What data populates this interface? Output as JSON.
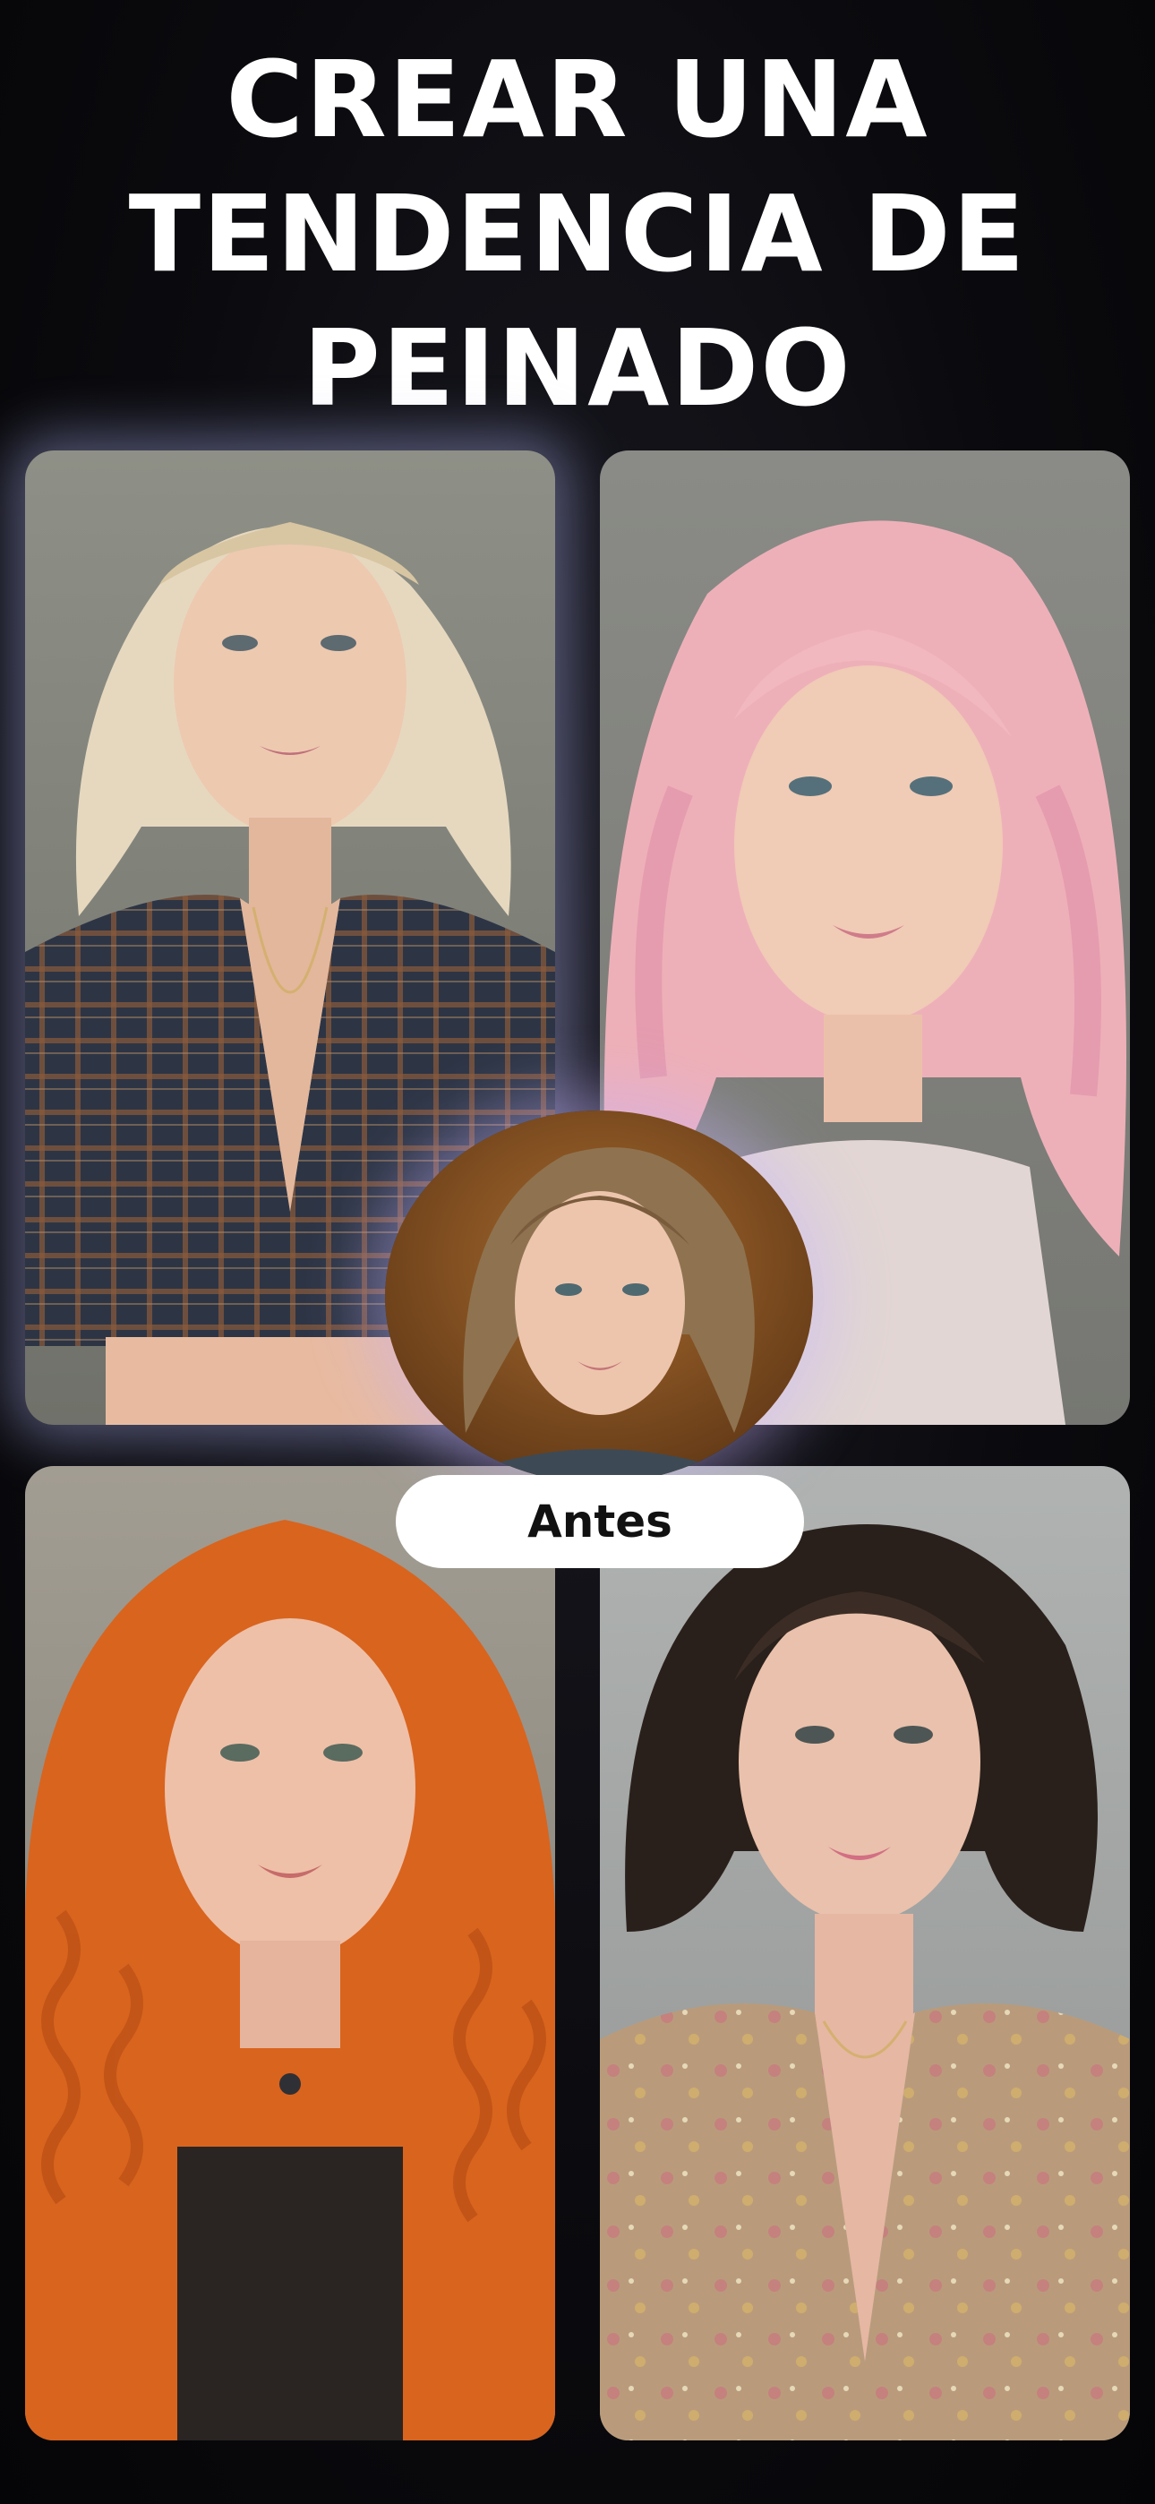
{
  "headline": {
    "line1": "CREAR UNA",
    "line2": "TENDENCIA DE",
    "line3": "PEINADO"
  },
  "before_label": "Antes",
  "photos": [
    {
      "name": "blonde-bob-portrait",
      "hair_color": "#e6d8bf"
    },
    {
      "name": "pink-waves-portrait",
      "hair_color": "#eeb0b8"
    },
    {
      "name": "red-curls-portrait",
      "hair_color": "#d9641e"
    },
    {
      "name": "dark-bob-portrait",
      "hair_color": "#2a201b"
    }
  ],
  "colors": {
    "background": "#0b0b0f",
    "headline_text": "#ffffff",
    "pill_bg": "#ffffff",
    "pill_text": "#111111",
    "glow": "#aab0eb"
  }
}
